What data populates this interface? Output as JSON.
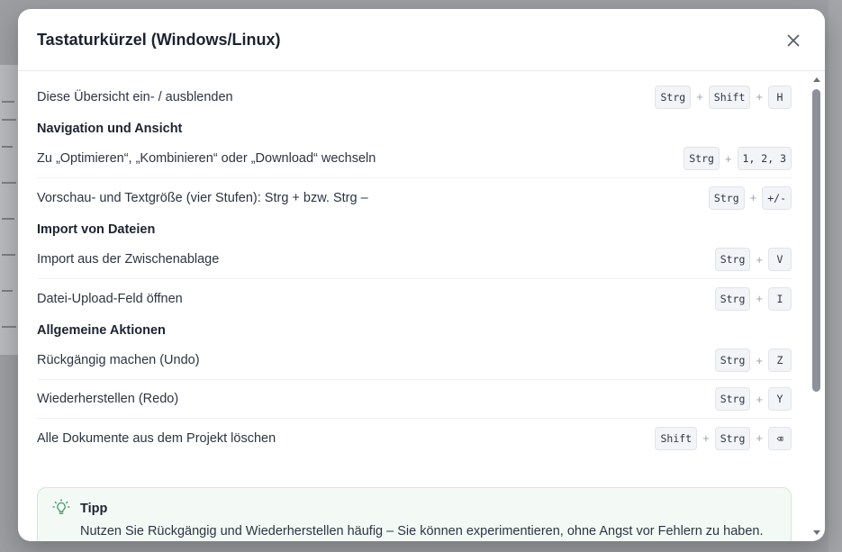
{
  "modal": {
    "title": "Tastaturkürzel (Windows/Linux)",
    "close_label": "×"
  },
  "rows_top": [
    {
      "label": "Diese Übersicht ein- / ausblenden",
      "keys": [
        "Strg",
        "Shift",
        "H"
      ]
    }
  ],
  "sections": [
    {
      "title": "Navigation und Ansicht",
      "rows": [
        {
          "label": "Zu „Optimieren“, „Kombinieren“ oder „Download“ wechseln",
          "keys": [
            "Strg",
            "1, 2, 3"
          ]
        },
        {
          "label": "Vorschau- und Textgröße (vier Stufen): Strg + bzw. Strg –",
          "keys": [
            "Strg",
            "+/-"
          ]
        }
      ]
    },
    {
      "title": "Import von Dateien",
      "rows": [
        {
          "label": "Import aus der Zwischenablage",
          "keys": [
            "Strg",
            "V"
          ]
        },
        {
          "label": "Datei-Upload-Feld öffnen",
          "keys": [
            "Strg",
            "I"
          ]
        }
      ]
    },
    {
      "title": "Allgemeine Aktionen",
      "rows": [
        {
          "label": "Rückgängig machen (Undo)",
          "keys": [
            "Strg",
            "Z"
          ]
        },
        {
          "label": "Wiederherstellen (Redo)",
          "keys": [
            "Strg",
            "Y"
          ]
        },
        {
          "label": "Alle Dokumente aus dem Projekt löschen",
          "keys": [
            "Shift",
            "Strg",
            "⌫"
          ]
        }
      ]
    }
  ],
  "key_separator": "+",
  "tip": {
    "title": "Tipp",
    "text": "Nutzen Sie Rückgängig und Wiederherstellen häufig – Sie können experimentieren, ohne Angst vor Fehlern zu haben."
  },
  "icons": {
    "close": "close-icon",
    "tip": "lightbulb-icon"
  },
  "colors": {
    "tip_background": "#f3faf6",
    "tip_border": "#cfe8da",
    "tip_icon": "#3f9a63",
    "title_text": "#1c2330"
  }
}
